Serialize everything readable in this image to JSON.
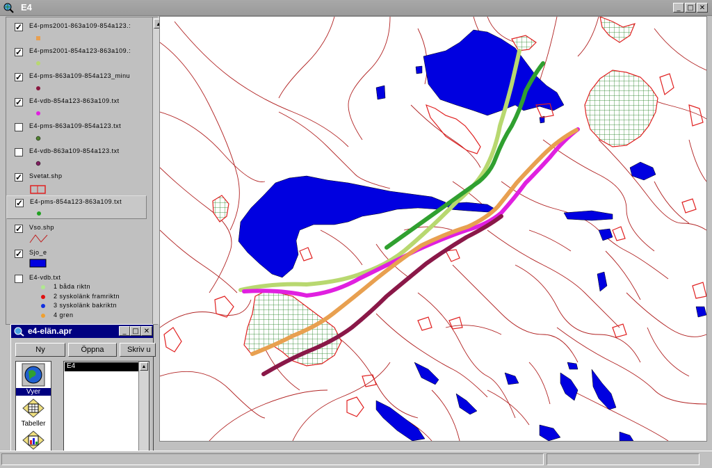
{
  "window": {
    "title": "E4"
  },
  "toc": {
    "layers": [
      {
        "name": "E4-pms2001-863a109-854a123.:",
        "checked": true,
        "color": "#e8a050"
      },
      {
        "name": "E4-pms2001-854a123-863a109.:",
        "checked": true,
        "color": "#b8d870"
      },
      {
        "name": "E4-pms-863a109-854a123_minu",
        "checked": true,
        "color": "#8a1840"
      },
      {
        "name": "E4-vdb-854a123-863a109.txt",
        "checked": true,
        "color": "#e020e0"
      },
      {
        "name": "E4-pms-863a109-854a123.txt",
        "checked": false,
        "color": "#508030"
      },
      {
        "name": "E4-vdb-863a109-854a123.txt",
        "checked": false,
        "color": "#802060"
      },
      {
        "name": "Svetat.shp",
        "checked": true,
        "color": "#e02020"
      },
      {
        "name": "E4-pms-854a123-863a109.txt",
        "checked": true,
        "color": "#20a020"
      },
      {
        "name": "Vso.shp",
        "checked": true,
        "color": "#c02020"
      },
      {
        "name": "Sjo_e",
        "checked": true,
        "color": "#0000e0"
      },
      {
        "name": "E4-vdb.txt",
        "checked": false,
        "color": ""
      }
    ],
    "legend": [
      {
        "label": "1 båda riktn",
        "color": "#b0e890"
      },
      {
        "label": "2 syskolänk framriktn",
        "color": "#e01010"
      },
      {
        "label": "3 syskolänk bakriktn",
        "color": "#1030e0"
      },
      {
        "label": "4 gren",
        "color": "#f0a030"
      }
    ]
  },
  "project": {
    "title": "e4-elän.apr",
    "buttons": [
      "Ny",
      "Öppna",
      "Skriv u"
    ],
    "icons": [
      "Vyer",
      "Tabeller"
    ],
    "list": [
      "E4"
    ]
  },
  "colors": {
    "water": "#0000e0",
    "roads": "#b02020",
    "urban": "#e02020"
  }
}
